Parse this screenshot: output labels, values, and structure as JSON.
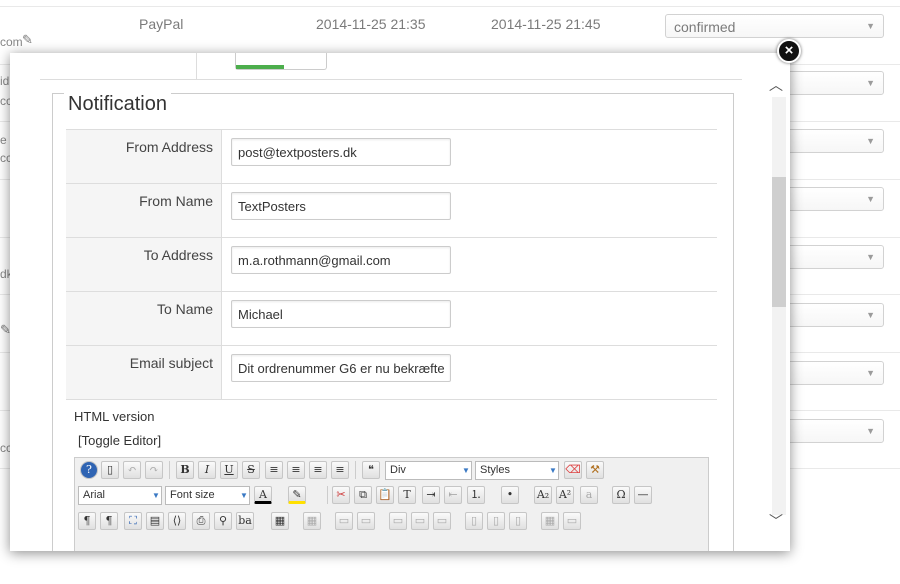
{
  "background": {
    "first_row": {
      "method": "PayPal",
      "created": "2014-11-25 21:35",
      "updated": "2014-11-25 21:45",
      "status": "confirmed"
    },
    "left_fragments": [
      "com",
      "id",
      "cc",
      "e",
      "cc",
      "dk",
      "cc"
    ]
  },
  "modal": {
    "section_title": "Notification",
    "fields": [
      {
        "label": "From Address",
        "value": "post@textposters.dk"
      },
      {
        "label": "From Name",
        "value": "TextPosters"
      },
      {
        "label": "To Address",
        "value": "m.a.rothmann@gmail.com"
      },
      {
        "label": "To Name",
        "value": "Michael"
      },
      {
        "label": "Email subject",
        "value": "Dit ordrenummer G6 er nu bekræfte"
      }
    ],
    "html_version_label": "HTML version",
    "toggle_editor": "[Toggle Editor]",
    "editor": {
      "format_value": "Div",
      "styles_value": "Styles",
      "font_value": "Arial",
      "size_value": "Font size"
    }
  }
}
